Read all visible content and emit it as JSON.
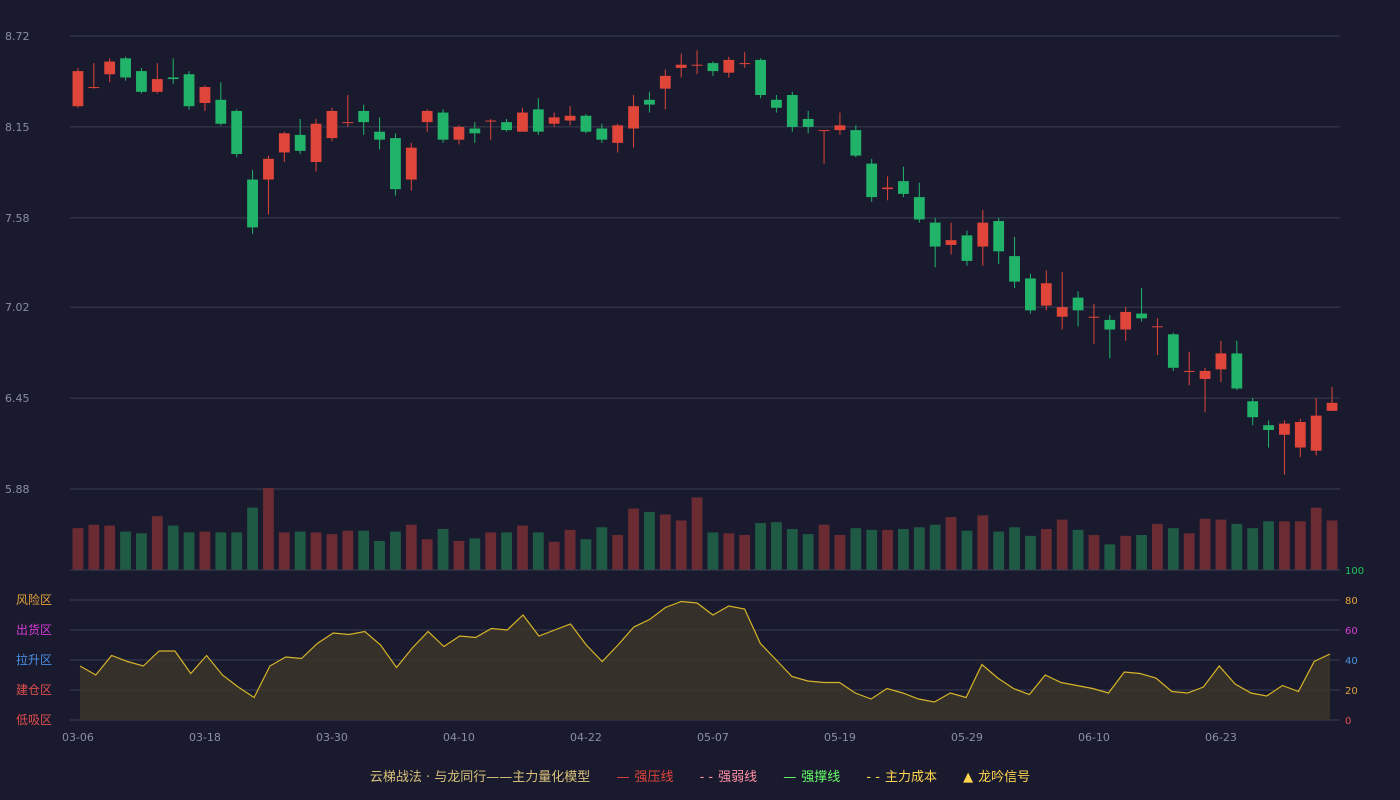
{
  "colors": {
    "background": "#1a1a2e",
    "up": "#e0453a",
    "down": "#22b36b",
    "grid": "#3a3d52",
    "axis_text": "#8a8fa3",
    "volume_up": "#6b2b33",
    "volume_down": "#1f5a45",
    "model_line": "#d6b428",
    "model_fill": "#3b3528"
  },
  "legend": {
    "prefix": "云梯战法 · 与龙同行——主力量化模型",
    "items": [
      {
        "symbol": "—",
        "label": "强压线",
        "color": "#e0453a"
      },
      {
        "symbol": "- -",
        "label": "强弱线",
        "color": "#ff8fa3"
      },
      {
        "symbol": "—",
        "label": "强撑线",
        "color": "#66ff66"
      },
      {
        "symbol": "- -",
        "label": "主力成本",
        "color": "#ffd54f"
      },
      {
        "symbol": "▲",
        "label": "龙吟信号",
        "color": "#ffd54f"
      }
    ]
  },
  "chart_data": {
    "type": "candlestick",
    "x_tick_labels": [
      "03-06",
      "03-18",
      "03-30",
      "04-10",
      "04-22",
      "05-07",
      "05-19",
      "05-29",
      "06-10",
      "06-23"
    ],
    "x_tick_indices": [
      0,
      8,
      16,
      24,
      32,
      40,
      48,
      56,
      64,
      72
    ],
    "price_axis": {
      "ticks": [
        "8.72",
        "8.15",
        "7.58",
        "7.02",
        "6.45",
        "5.88"
      ],
      "ylim": [
        5.88,
        8.72
      ]
    },
    "candles": [
      [
        8.28,
        8.5,
        8.52,
        8.27
      ],
      [
        8.4,
        8.4,
        8.55,
        8.39
      ],
      [
        8.48,
        8.56,
        8.58,
        8.43
      ],
      [
        8.58,
        8.46,
        8.59,
        8.44
      ],
      [
        8.5,
        8.37,
        8.52,
        8.36
      ],
      [
        8.37,
        8.45,
        8.55,
        8.36
      ],
      [
        8.46,
        8.45,
        8.58,
        8.42
      ],
      [
        8.48,
        8.28,
        8.5,
        8.26
      ],
      [
        8.3,
        8.4,
        8.41,
        8.25
      ],
      [
        8.32,
        8.17,
        8.43,
        8.16
      ],
      [
        8.25,
        7.98,
        8.26,
        7.96
      ],
      [
        7.82,
        7.52,
        7.88,
        7.48
      ],
      [
        7.82,
        7.95,
        7.97,
        7.6
      ],
      [
        7.99,
        8.11,
        8.12,
        7.93
      ],
      [
        8.1,
        8.0,
        8.2,
        7.98
      ],
      [
        7.93,
        8.17,
        8.2,
        7.87
      ],
      [
        8.08,
        8.25,
        8.27,
        8.06
      ],
      [
        8.18,
        8.18,
        8.35,
        8.15
      ],
      [
        8.25,
        8.18,
        8.29,
        8.1
      ],
      [
        8.12,
        8.07,
        8.21,
        8.01
      ],
      [
        8.08,
        7.76,
        8.11,
        7.72
      ],
      [
        7.82,
        8.02,
        8.05,
        7.75
      ],
      [
        8.18,
        8.25,
        8.26,
        8.12
      ],
      [
        8.24,
        8.07,
        8.26,
        8.05
      ],
      [
        8.07,
        8.15,
        8.16,
        8.04
      ],
      [
        8.14,
        8.11,
        8.18,
        8.05
      ],
      [
        8.19,
        8.19,
        8.2,
        8.07
      ],
      [
        8.18,
        8.13,
        8.2,
        8.12
      ],
      [
        8.12,
        8.24,
        8.27,
        8.12
      ],
      [
        8.26,
        8.12,
        8.33,
        8.1
      ],
      [
        8.17,
        8.21,
        8.24,
        8.15
      ],
      [
        8.19,
        8.22,
        8.28,
        8.16
      ],
      [
        8.22,
        8.12,
        8.23,
        8.11
      ],
      [
        8.14,
        8.07,
        8.17,
        8.05
      ],
      [
        8.05,
        8.16,
        8.17,
        7.99
      ],
      [
        8.14,
        8.28,
        8.35,
        8.02
      ],
      [
        8.32,
        8.29,
        8.37,
        8.24
      ],
      [
        8.39,
        8.47,
        8.51,
        8.26
      ],
      [
        8.52,
        8.54,
        8.61,
        8.46
      ],
      [
        8.54,
        8.54,
        8.63,
        8.48
      ],
      [
        8.55,
        8.5,
        8.56,
        8.47
      ],
      [
        8.49,
        8.57,
        8.59,
        8.46
      ],
      [
        8.55,
        8.55,
        8.62,
        8.52
      ],
      [
        8.57,
        8.35,
        8.58,
        8.33
      ],
      [
        8.32,
        8.27,
        8.35,
        8.24
      ],
      [
        8.35,
        8.15,
        8.37,
        8.12
      ],
      [
        8.2,
        8.15,
        8.25,
        8.11
      ],
      [
        8.13,
        8.13,
        8.13,
        7.92
      ],
      [
        8.13,
        8.16,
        8.24,
        8.1
      ],
      [
        8.13,
        7.97,
        8.16,
        7.96
      ],
      [
        7.92,
        7.71,
        7.95,
        7.68
      ],
      [
        7.76,
        7.77,
        7.84,
        7.69
      ],
      [
        7.81,
        7.73,
        7.9,
        7.71
      ],
      [
        7.71,
        7.57,
        7.8,
        7.55
      ],
      [
        7.55,
        7.4,
        7.58,
        7.27
      ],
      [
        7.41,
        7.44,
        7.55,
        7.35
      ],
      [
        7.47,
        7.31,
        7.5,
        7.28
      ],
      [
        7.4,
        7.55,
        7.63,
        7.28
      ],
      [
        7.56,
        7.37,
        7.58,
        7.29
      ],
      [
        7.34,
        7.18,
        7.46,
        7.14
      ],
      [
        7.2,
        7.0,
        7.23,
        6.98
      ],
      [
        7.03,
        7.17,
        7.25,
        7.0
      ],
      [
        6.96,
        7.02,
        7.24,
        6.88
      ],
      [
        7.08,
        7.0,
        7.12,
        6.9
      ],
      [
        6.96,
        6.96,
        7.04,
        6.79
      ],
      [
        6.94,
        6.88,
        6.97,
        6.7
      ],
      [
        6.88,
        6.99,
        7.02,
        6.81
      ],
      [
        6.98,
        6.95,
        7.14,
        6.93
      ],
      [
        6.9,
        6.9,
        6.95,
        6.72
      ],
      [
        6.85,
        6.64,
        6.86,
        6.62
      ],
      [
        6.62,
        6.62,
        6.74,
        6.53
      ],
      [
        6.57,
        6.62,
        6.64,
        6.36
      ],
      [
        6.63,
        6.73,
        6.81,
        6.55
      ],
      [
        6.73,
        6.51,
        6.81,
        6.5
      ],
      [
        6.43,
        6.33,
        6.45,
        6.28
      ],
      [
        6.28,
        6.25,
        6.31,
        6.14
      ],
      [
        6.22,
        6.29,
        6.31,
        5.97
      ],
      [
        6.14,
        6.3,
        6.32,
        6.08
      ],
      [
        6.12,
        6.34,
        6.45,
        6.09
      ],
      [
        6.37,
        6.42,
        6.52,
        6.38
      ]
    ],
    "volume": [
      49,
      53,
      52,
      45,
      43,
      63,
      52,
      44,
      45,
      44,
      44,
      73,
      96,
      44,
      45,
      44,
      42,
      46,
      46,
      34,
      45,
      53,
      36,
      48,
      34,
      37,
      44,
      44,
      52,
      44,
      33,
      47,
      36,
      50,
      41,
      72,
      68,
      65,
      58,
      85,
      44,
      43,
      41,
      55,
      56,
      48,
      42,
      53,
      41,
      49,
      47,
      47,
      48,
      50,
      53,
      62,
      46,
      64,
      45,
      50,
      40,
      48,
      59,
      47,
      41,
      30,
      40,
      41,
      54,
      49,
      43,
      60,
      59,
      54,
      49,
      57,
      57,
      57,
      73,
      58
    ],
    "model": {
      "right_axis_ticks": [
        100,
        80,
        60,
        40,
        20,
        0
      ],
      "zones": [
        {
          "label": "风险区",
          "color": "#e6a23c"
        },
        {
          "label": "出货区",
          "color": "#d63bd6"
        },
        {
          "label": "拉升区",
          "color": "#4a90e2"
        },
        {
          "label": "建仓区",
          "color": "#e04e4e"
        },
        {
          "label": "低吸区",
          "color": "#e04e4e"
        }
      ],
      "values": [
        36,
        30,
        43,
        39,
        36,
        46,
        46,
        31,
        43,
        30,
        22,
        15,
        36,
        42,
        41,
        51,
        58,
        57,
        59,
        50,
        35,
        48,
        59,
        49,
        56,
        55,
        61,
        60,
        70,
        56,
        60,
        64,
        50,
        39,
        50,
        62,
        67,
        75,
        79,
        78,
        70,
        76,
        74,
        51,
        40,
        29,
        26,
        25,
        25,
        18,
        14,
        21,
        18,
        14,
        12,
        18,
        15,
        37,
        28,
        21,
        17,
        30,
        25,
        23,
        21,
        18,
        32,
        31,
        28,
        19,
        18,
        22,
        36,
        24,
        18,
        16,
        23,
        19,
        39,
        44
      ]
    }
  }
}
